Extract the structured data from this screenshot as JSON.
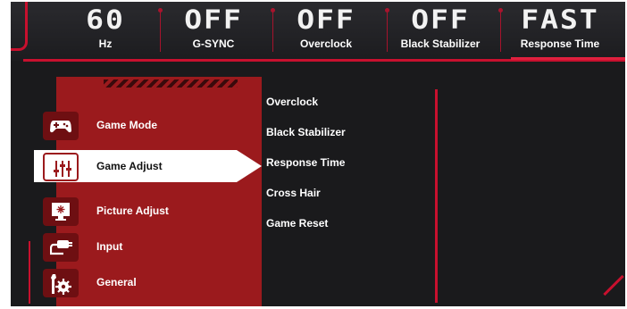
{
  "status_bar": [
    {
      "value": "60",
      "label": "Hz"
    },
    {
      "value": "OFF",
      "label": "G-SYNC"
    },
    {
      "value": "OFF",
      "label": "Overclock"
    },
    {
      "value": "OFF",
      "label": "Black Stabilizer"
    },
    {
      "value": "FAST",
      "label": "Response Time"
    }
  ],
  "main_menu": [
    {
      "label": "Game Mode",
      "icon": "gamepad-icon",
      "selected": false
    },
    {
      "label": "Game Adjust",
      "icon": "sliders-icon",
      "selected": true
    },
    {
      "label": "Picture Adjust",
      "icon": "monitor-brightness-icon",
      "selected": false
    },
    {
      "label": "Input",
      "icon": "input-plug-icon",
      "selected": false
    },
    {
      "label": "General",
      "icon": "wrench-gear-icon",
      "selected": false
    }
  ],
  "sub_menu": [
    "Overclock",
    "Black Stabilizer",
    "Response Time",
    "Cross Hair",
    "Game Reset"
  ],
  "colors": {
    "accent": "#c8102e",
    "panel": "#9b1a1d",
    "background": "#1a1a1c"
  }
}
